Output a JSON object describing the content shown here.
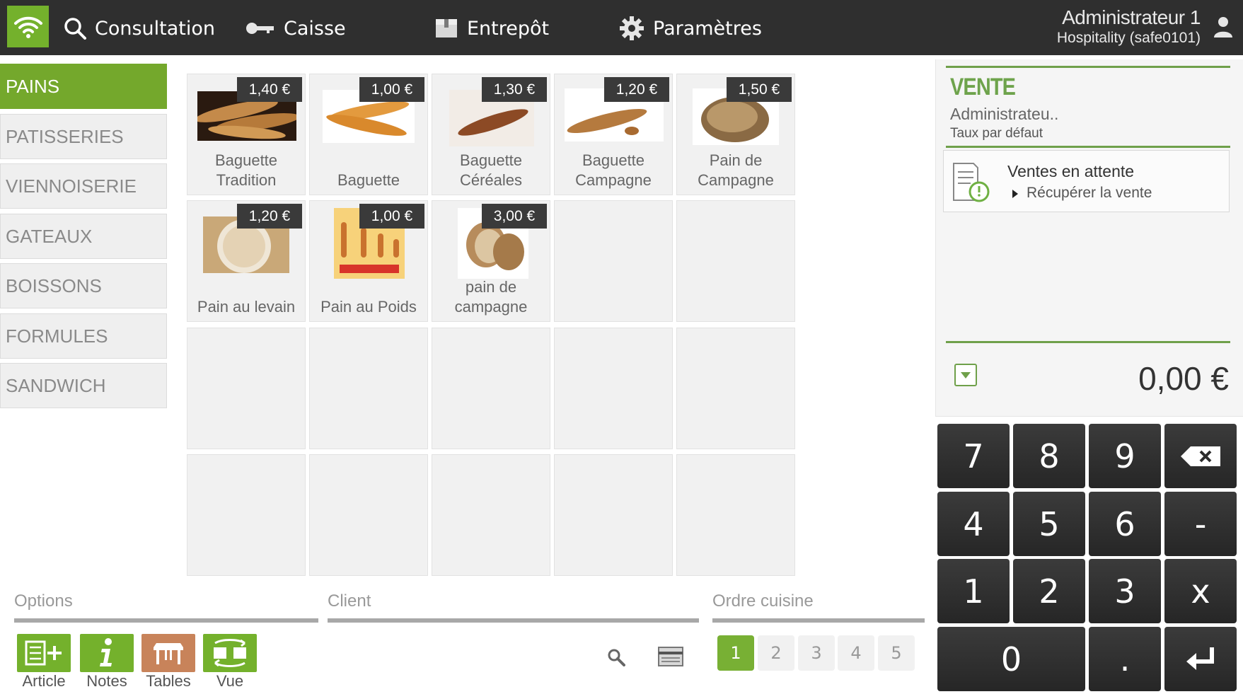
{
  "topbar": {
    "nav": [
      {
        "label": "Consultation",
        "icon": "search-icon"
      },
      {
        "label": "Caisse",
        "icon": "key-icon"
      },
      {
        "label": "Entrepôt",
        "icon": "box-icon"
      },
      {
        "label": "Paramètres",
        "icon": "gear-icon"
      }
    ],
    "user_name": "Administrateur 1",
    "user_company": "Hospitality (safe0101)"
  },
  "categories": [
    "PAINS",
    "PATISSERIES",
    "VIENNOISERIE",
    "GATEAUX",
    "BOISSONS",
    "FORMULES",
    "SANDWICH"
  ],
  "active_category": "PAINS",
  "products": [
    {
      "name": "Baguette Tradition",
      "price": "1,40 €"
    },
    {
      "name": "Baguette",
      "price": "1,00 €"
    },
    {
      "name": "Baguette Céréales",
      "price": "1,30 €"
    },
    {
      "name": "Baguette Campagne",
      "price": "1,20 €"
    },
    {
      "name": "Pain de Campagne",
      "price": "1,50 €"
    },
    {
      "name": "Pain au levain",
      "price": "1,20 €"
    },
    {
      "name": "Pain au Poids",
      "price": "1,00 €"
    },
    {
      "name": "pain de campagne",
      "price": "3,00 €"
    }
  ],
  "sections": {
    "options": "Options",
    "client": "Client",
    "ordre": "Ordre cuisine"
  },
  "options": [
    {
      "label": "Article",
      "icon": "add-article-icon",
      "color": "#74b12c"
    },
    {
      "label": "Notes",
      "icon": "info-icon",
      "color": "#74b12c"
    },
    {
      "label": "Tables",
      "icon": "table-icon",
      "color": "#c8835a"
    },
    {
      "label": "Vue",
      "icon": "view-switch-icon",
      "color": "#74b12c"
    }
  ],
  "order_numbers": [
    "1",
    "2",
    "3",
    "4",
    "5"
  ],
  "active_order": "1",
  "sale": {
    "title": "VENTE",
    "user": "Administrateu..",
    "rate": "Taux par défaut",
    "pending_title": "Ventes en attente",
    "pending_action": "Récupérer la vente",
    "total": "0,00 €"
  },
  "keypad": [
    "7",
    "8",
    "9",
    "4",
    "5",
    "6",
    "-",
    "1",
    "2",
    "3",
    "x",
    "0",
    "."
  ],
  "colors": {
    "accent": "#74b12c",
    "topbar": "#2f2f2f",
    "tables": "#c8835a"
  }
}
